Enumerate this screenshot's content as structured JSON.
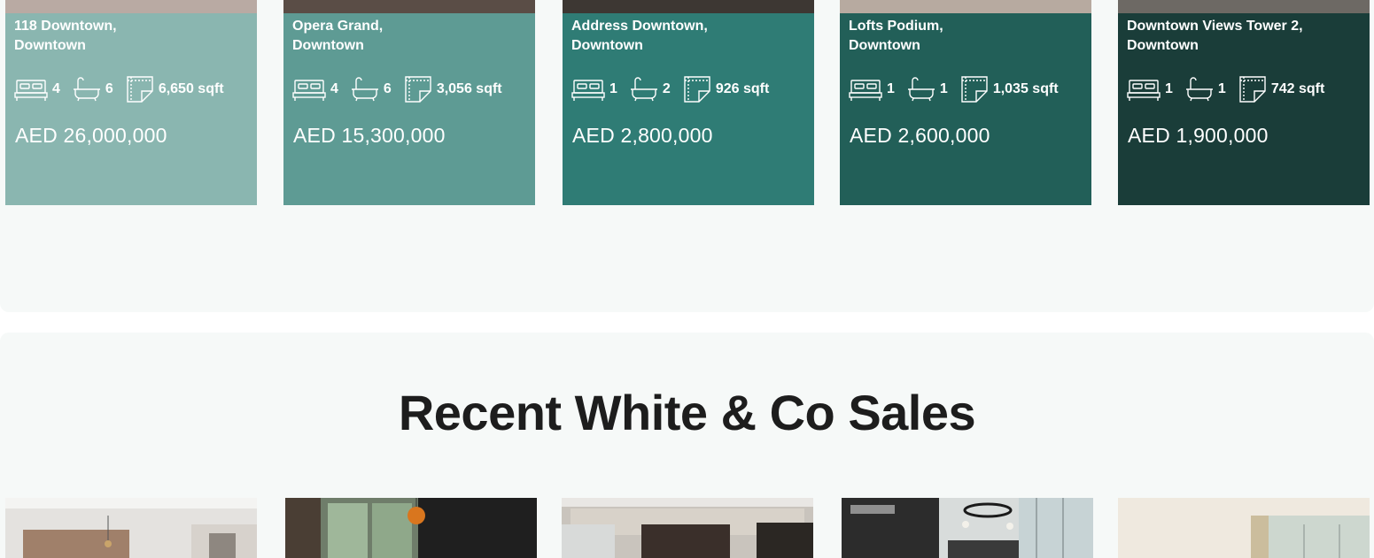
{
  "listings": [
    {
      "name_line1": "118 Downtown,",
      "name_line2": "Downtown",
      "beds": "4",
      "baths": "6",
      "area": "6,650 sqft",
      "price": "AED 26,000,000",
      "color": "#8ab6b0"
    },
    {
      "name_line1": "Opera Grand,",
      "name_line2": "Downtown",
      "beds": "4",
      "baths": "6",
      "area": "3,056 sqft",
      "price": "AED 15,300,000",
      "color": "#5e9b94"
    },
    {
      "name_line1": "Address Downtown,",
      "name_line2": "Downtown",
      "beds": "1",
      "baths": "2",
      "area": "926 sqft",
      "price": "AED 2,800,000",
      "color": "#2f7c75"
    },
    {
      "name_line1": "Lofts Podium,",
      "name_line2": "Downtown",
      "beds": "1",
      "baths": "1",
      "area": "1,035 sqft",
      "price": "AED 2,600,000",
      "color": "#225f58"
    },
    {
      "name_line1": "Downtown Views Tower 2,",
      "name_line2": "Downtown",
      "beds": "1",
      "baths": "1",
      "area": "742 sqft",
      "price": "AED 1,900,000",
      "color": "#1a3d39"
    }
  ],
  "recent_sales": {
    "heading": "Recent White & Co Sales"
  },
  "icons": {
    "bed": "bed-icon",
    "bath": "bathtub-icon",
    "area": "floor-plan-icon"
  },
  "colors": {
    "section_bg": "#f6f9f8",
    "heading": "#1d1d1d"
  }
}
